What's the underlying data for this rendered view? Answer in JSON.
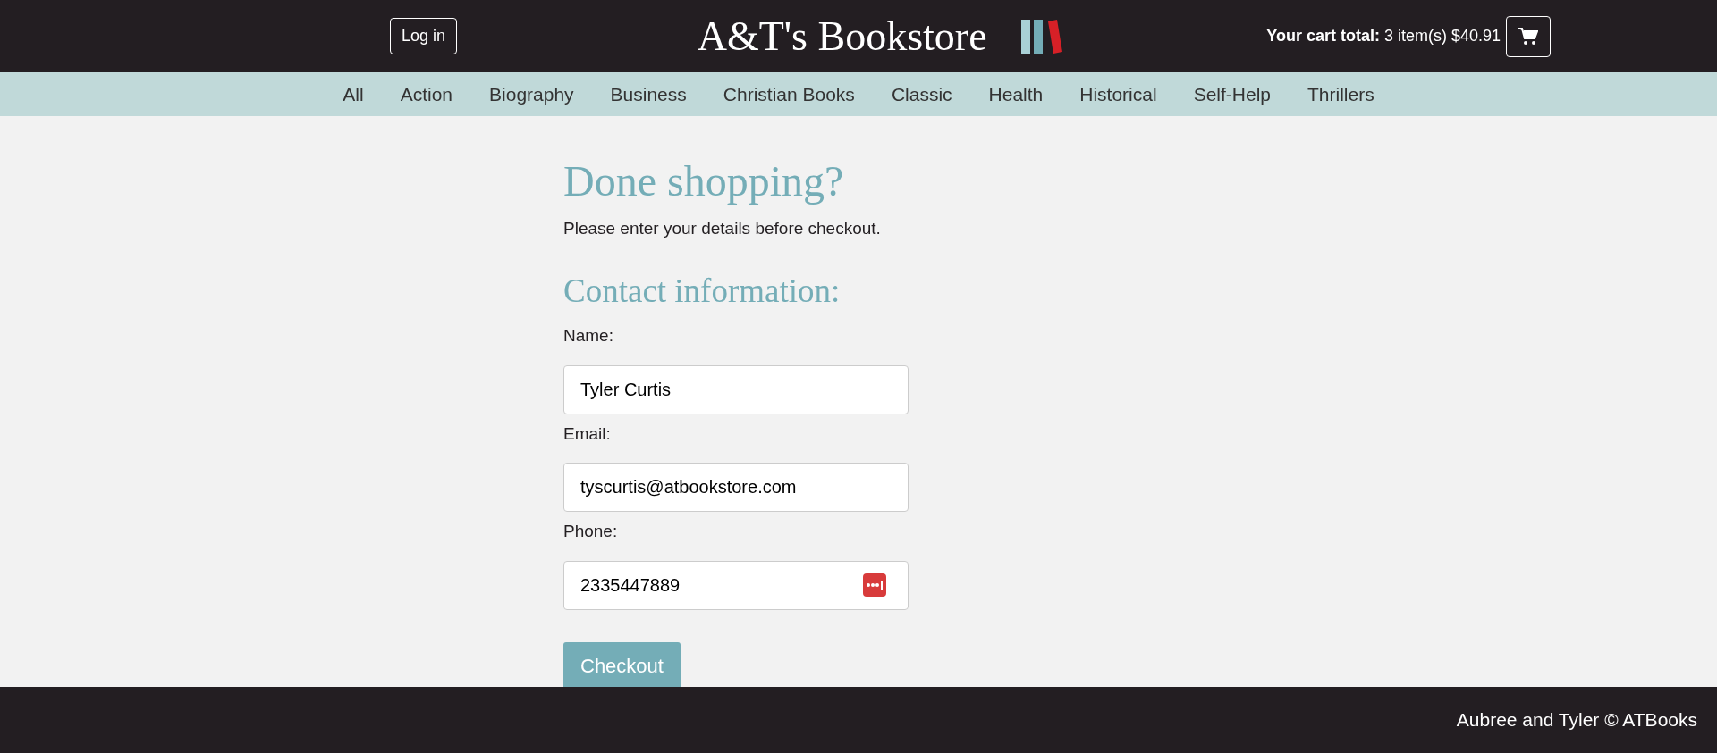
{
  "header": {
    "login_button": "Log in",
    "title": "A&T's Bookstore",
    "cart_total": "**Your cart total:** 3 item(s) $40.91"
  },
  "categories": [
    {
      "label": "All"
    },
    {
      "label": "Action"
    },
    {
      "label": "Biography"
    },
    {
      "label": "Business"
    },
    {
      "label": "Christian Books"
    },
    {
      "label": "Classic"
    },
    {
      "label": "Health"
    },
    {
      "label": "Historical"
    },
    {
      "label": "Self-Help"
    },
    {
      "label": "Thrillers"
    }
  ],
  "checkout": {
    "heading": "Done shopping?",
    "intro": "Please enter your details before checkout.",
    "section_heading": "Contact information:",
    "fields": [
      {
        "label": "Name:",
        "value": "Tyler Curtis",
        "password_manager": false
      },
      {
        "label": "Email:",
        "value": "tyscurtis@atbookstore.com",
        "password_manager": false
      },
      {
        "label": "Phone:",
        "value": "2335447889",
        "password_manager": true
      }
    ],
    "button": "Checkout"
  },
  "footer": "Aubree and Tyler © ATBooks"
}
